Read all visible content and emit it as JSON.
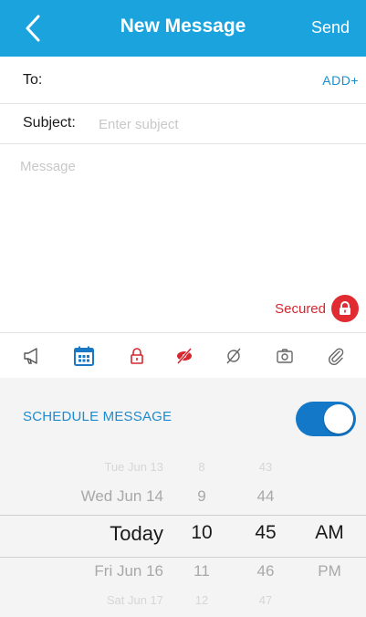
{
  "header": {
    "title": "New Message",
    "send_label": "Send",
    "back_icon": "chevron-left-icon",
    "background": "#1aa3dd"
  },
  "compose": {
    "to_label": "To:",
    "add_label": "ADD+",
    "subject_label": "Subject:",
    "subject_placeholder": "Enter subject",
    "message_placeholder": "Message",
    "secured_label": "Secured"
  },
  "toolbar": {
    "icons": [
      "megaphone-icon",
      "calendar-icon",
      "lock-icon",
      "hidden-eye-icon",
      "no-signal-icon",
      "camera-icon",
      "paperclip-icon"
    ]
  },
  "schedule": {
    "label": "SCHEDULE MESSAGE",
    "enabled": true,
    "picker": {
      "days": [
        "Tue Jun 13",
        "Wed Jun 14",
        "Today",
        "Fri Jun 16",
        "Sat Jun 17"
      ],
      "hours": [
        "8",
        "9",
        "10",
        "11",
        "12"
      ],
      "minutes": [
        "43",
        "44",
        "45",
        "46",
        "47"
      ],
      "ampm": [
        "",
        "",
        "AM",
        "PM",
        ""
      ],
      "selected": {
        "day": "Today",
        "hour": "10",
        "minute": "45",
        "ampm": "AM"
      }
    }
  },
  "colors": {
    "accent": "#1aa3dd",
    "link": "#1a8fd0",
    "secured_red": "#e02b33",
    "toggle_on": "#1478c8"
  }
}
